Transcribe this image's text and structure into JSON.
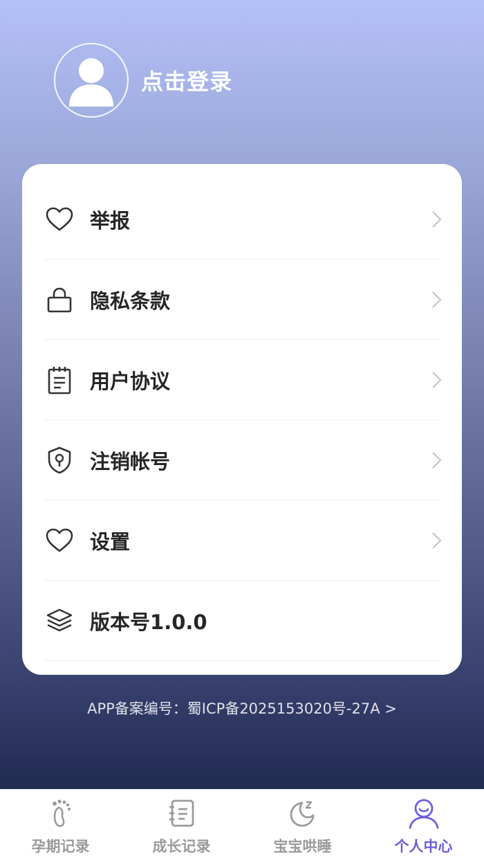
{
  "profile": {
    "login_label": "点击登录"
  },
  "menu": [
    {
      "label": "举报",
      "icon": "heart-icon"
    },
    {
      "label": "隐私条款",
      "icon": "lock-icon"
    },
    {
      "label": "用户协议",
      "icon": "notepad-icon"
    },
    {
      "label": "注销帐号",
      "icon": "shield-keyhole-icon"
    },
    {
      "label": "设置",
      "icon": "heart-icon"
    },
    {
      "label": "版本号1.0.0",
      "icon": "layers-icon"
    }
  ],
  "icp": {
    "text": "APP备案编号：蜀ICP备2025153020号-27A >"
  },
  "tabs": [
    {
      "label": "孕期记录",
      "icon": "footprint-icon",
      "active": false
    },
    {
      "label": "成长记录",
      "icon": "notebook-icon",
      "active": false
    },
    {
      "label": "宝宝哄睡",
      "icon": "moon-sleep-icon",
      "active": false
    },
    {
      "label": "个人中心",
      "icon": "person-icon",
      "active": true
    }
  ],
  "colors": {
    "accent": "#6c5ed8",
    "inactive": "#9a9a9a",
    "text": "#262626"
  }
}
